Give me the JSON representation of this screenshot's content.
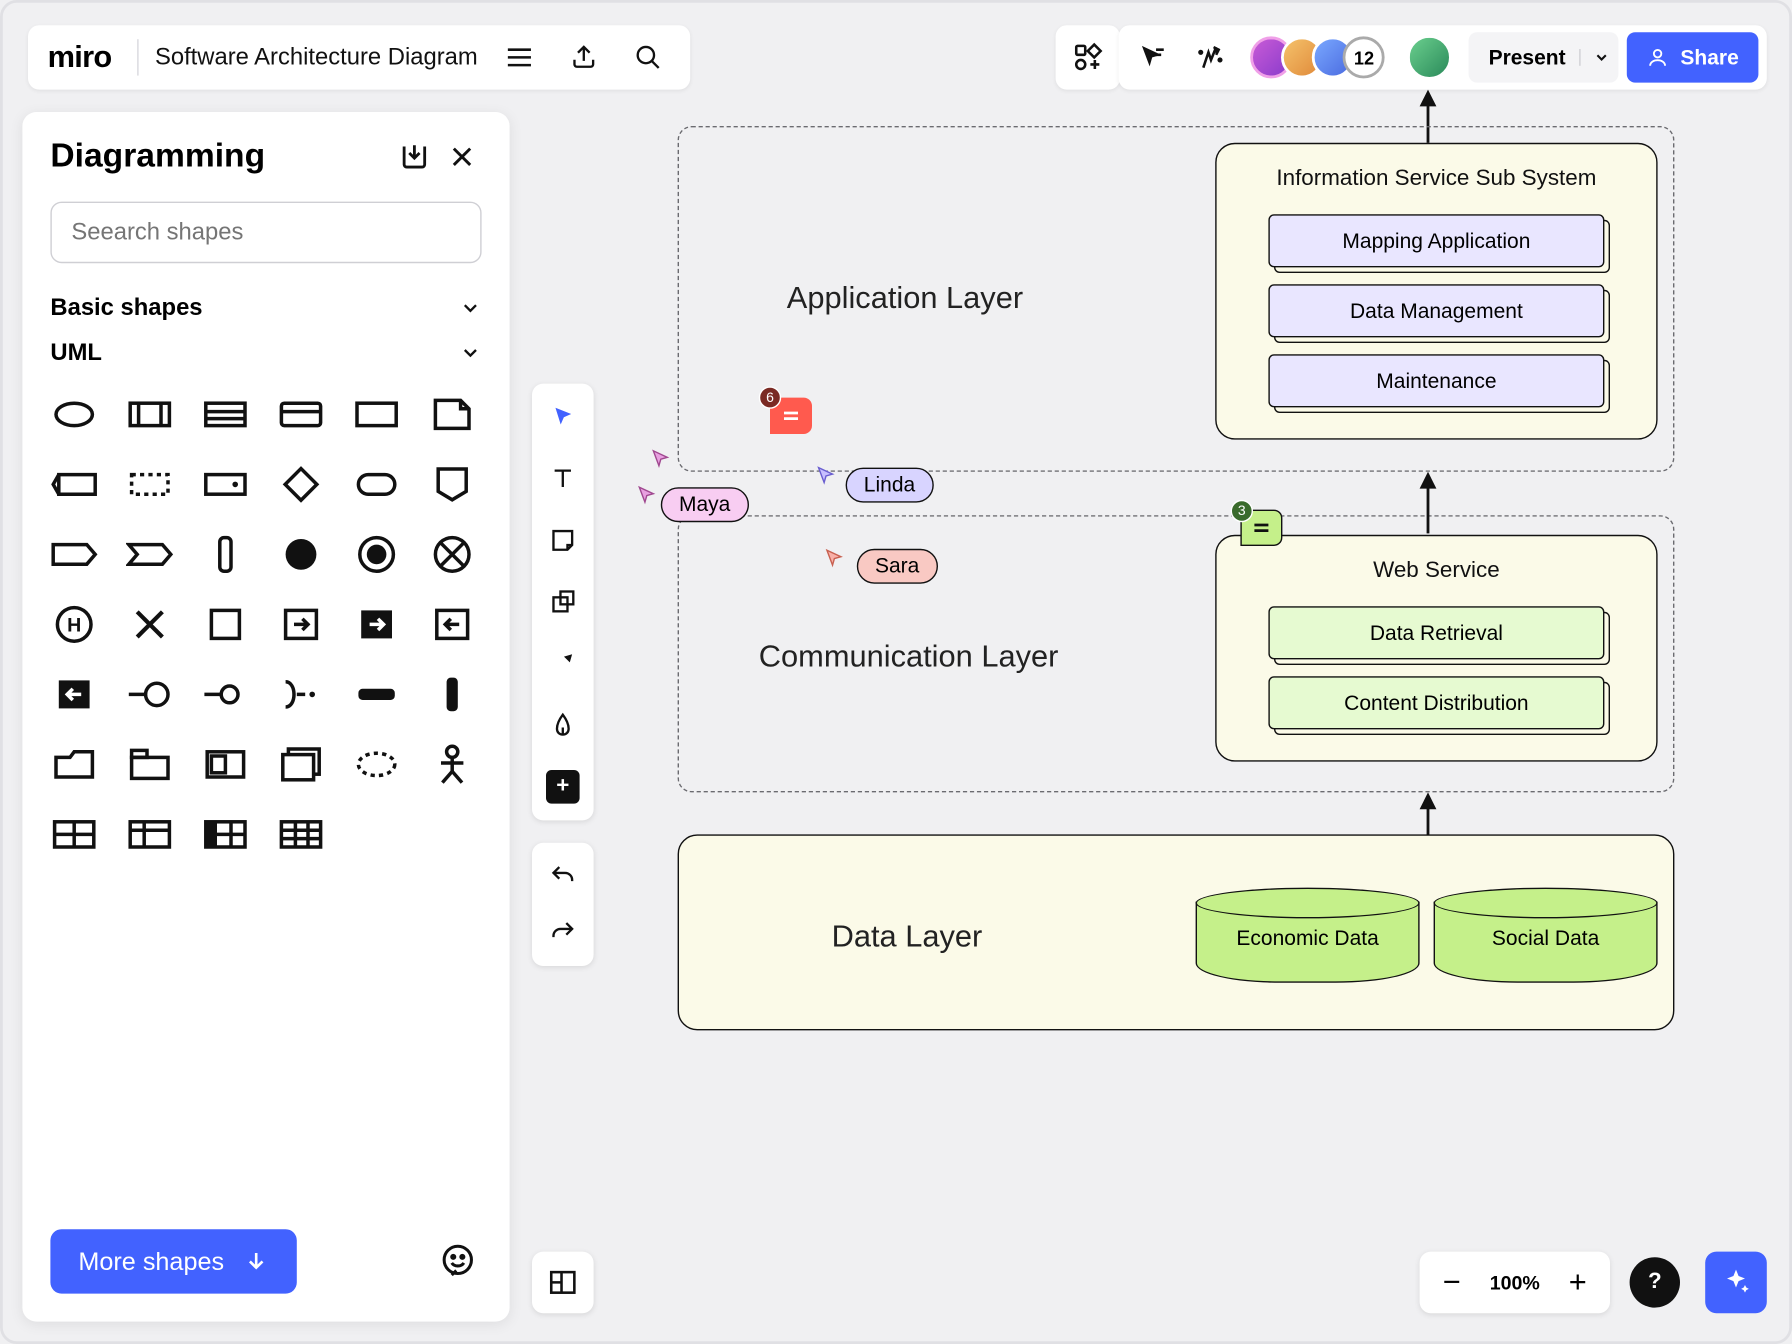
{
  "header": {
    "logo": "miro",
    "board_title": "Software Architecture Diagram"
  },
  "top_right": {
    "avatar_overflow": "12",
    "present_label": "Present",
    "share_label": "Share"
  },
  "sidebar": {
    "title": "Diagramming",
    "search_placeholder": "Seearch shapes",
    "sections": {
      "basic": "Basic shapes",
      "uml": "UML"
    },
    "more_shapes": "More shapes"
  },
  "zoom": {
    "value": "100%"
  },
  "help": {
    "label": "?"
  },
  "diagram": {
    "layers": {
      "application": "Application Layer",
      "communication": "Communication Layer",
      "data": "Data Layer"
    },
    "info_system": {
      "title": "Information Service Sub System",
      "items": [
        "Mapping Application",
        "Data Management",
        "Maintenance"
      ]
    },
    "web_service": {
      "title": "Web Service",
      "items": [
        "Data Retrieval",
        "Content Distribution"
      ]
    },
    "cylinders": [
      "Economic Data",
      "Social Data"
    ],
    "cursors": {
      "maya": "Maya",
      "linda": "Linda",
      "sara": "Sara"
    },
    "comments": {
      "red": "6",
      "green": "3"
    }
  }
}
